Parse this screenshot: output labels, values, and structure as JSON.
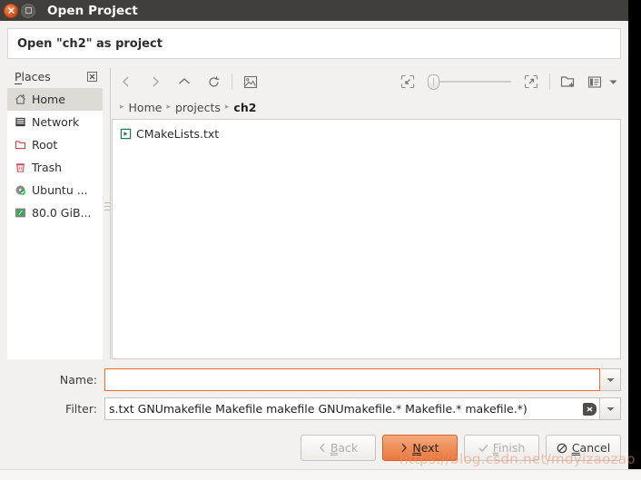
{
  "window": {
    "title": "Open Project",
    "close_icon": "close-icon",
    "maximize_icon": "maximize-icon"
  },
  "banner": {
    "heading": "Open \"ch2\" as project"
  },
  "places": {
    "title": "Places",
    "title_mnemonic": "P",
    "title_rest": "laces",
    "close_icon": "remove-place-icon",
    "items": [
      {
        "label": "Home",
        "icon": "home-icon",
        "selected": true
      },
      {
        "label": "Network",
        "icon": "network-icon",
        "selected": false
      },
      {
        "label": "Root",
        "icon": "folder-root-icon",
        "selected": false
      },
      {
        "label": "Trash",
        "icon": "trash-icon",
        "selected": false
      },
      {
        "label": "Ubuntu ...",
        "icon": "disc-icon",
        "selected": false
      },
      {
        "label": "80.0 GiB...",
        "icon": "drive-icon",
        "selected": false
      }
    ]
  },
  "toolbar": {
    "back_icon": "chevron-left-icon",
    "forward_icon": "chevron-right-icon",
    "up_icon": "chevron-up-icon",
    "reload_icon": "reload-icon",
    "preview_icon": "image-preview-icon",
    "zoom_out_icon": "zoom-out-icon",
    "zoom_in_icon": "zoom-in-icon",
    "new_folder_icon": "new-folder-icon",
    "view_mode_icon": "list-view-icon",
    "view_mode_caret": "chevron-down-icon",
    "zoom_slider_value": 0
  },
  "breadcrumb": {
    "items": [
      "Home",
      "projects",
      "ch2"
    ],
    "current_index": 2,
    "separator": "▸"
  },
  "files": [
    {
      "name": "CMakeLists.txt",
      "icon": "text-file-icon"
    }
  ],
  "form": {
    "name_label": "Name:",
    "name_value": "",
    "name_placeholder": "",
    "name_dropdown_icon": "chevron-down-icon",
    "filter_label": "Filter:",
    "filter_value": "s.txt GNUmakefile Makefile makefile GNUmakefile.* Makefile.* makefile.*)",
    "filter_clear_icon": "clear-icon",
    "filter_dropdown_icon": "chevron-down-icon"
  },
  "actions": [
    {
      "label": "Back",
      "icon": "chevron-left-icon",
      "mnemonic": "B",
      "rest": "ack",
      "state": "disabled",
      "primary": false
    },
    {
      "label": "Next",
      "icon": "chevron-right-icon",
      "mnemonic": "N",
      "rest": "ext",
      "state": "enabled",
      "primary": true
    },
    {
      "label": "Finish",
      "icon": "check-icon",
      "mnemonic": "F",
      "rest": "inish",
      "state": "disabled",
      "primary": false
    },
    {
      "label": "Cancel",
      "icon": "cancel-icon",
      "mnemonic": "C",
      "rest": "ancel",
      "state": "enabled",
      "primary": false
    }
  ],
  "watermark": {
    "text": "https://blog.csdn.net/mdyizaozao"
  },
  "colors": {
    "accent_orange": "#e9763c",
    "titlebar": "#413f3c",
    "window_bg": "#f2f1f0",
    "field_focus": "#e8702a"
  }
}
